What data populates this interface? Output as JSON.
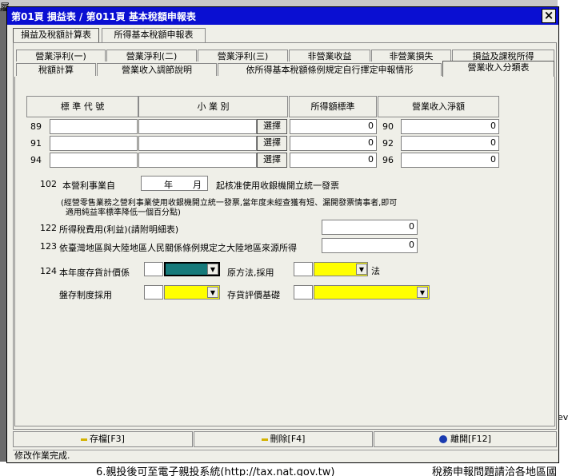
{
  "window": {
    "title": "第01頁 損益表 / 第011頁 基本稅額申報表"
  },
  "top_tabs": [
    "損益及稅額計算表",
    "所得基本稅額申報表"
  ],
  "tabs_row1": [
    "營業淨利(一)",
    "營業淨利(二)",
    "營業淨利(三)",
    "非營業收益",
    "非營業損失",
    "損益及課稅所得"
  ],
  "tabs_row2": [
    "稅額計算",
    "營業收入調節說明",
    "依所得基本稅額條例規定自行擇定申報情形",
    "營業收入分類表"
  ],
  "table": {
    "headers": [
      "標 準 代 號",
      "小 業 別",
      "所得額標準",
      "營業收入淨額"
    ],
    "rows": [
      {
        "code": "89",
        "btn": "選擇",
        "std": "0",
        "code2": "90",
        "net": "0"
      },
      {
        "code": "91",
        "btn": "選擇",
        "std": "0",
        "code2": "92",
        "net": "0"
      },
      {
        "code": "94",
        "btn": "選擇",
        "std": "0",
        "code2": "96",
        "net": "0"
      }
    ]
  },
  "f102": {
    "num": "102",
    "label": "本營利事業自",
    "year": "年",
    "month": "月",
    "suffix": "起核准使用收銀機開立統一發票",
    "note1": "(經營零售業務之營利事業使用收銀機開立統一發票,當年度未經查獲有短、漏開發票情事者,即可",
    "note2": "適用純益率標準降低一個百分點)"
  },
  "f122": {
    "num": "122",
    "label": "所得稅費用(利益)(請附明細表)",
    "value": "0"
  },
  "f123": {
    "num": "123",
    "label": "依臺灣地區與大陸地區人民關係條例規定之大陸地區來源所得",
    "value": "0"
  },
  "f124": {
    "num": "124",
    "label": "本年度存貨計價係",
    "method_label": "原方法,採用",
    "method_suffix": "法",
    "inventory_label": "盤存制度採用",
    "basis_label": "存貨評價基礎"
  },
  "buttons": {
    "save": "存檔[F3]",
    "delete": "刪除[F4]",
    "exit": "離開[F12]"
  },
  "status": "修改作業完成.",
  "background": {
    "left_text": "6.親投後可至電子親投系統(http://tax.nat.gov.tw)",
    "right_text": "稅務申報問題請洽各地區國",
    "left_edge": "屬",
    "right_edge": "ev"
  },
  "colors": {
    "title_bar": "#0a0fd2",
    "highlight_yellow": "#ffff00",
    "teal": "#167a7a"
  }
}
